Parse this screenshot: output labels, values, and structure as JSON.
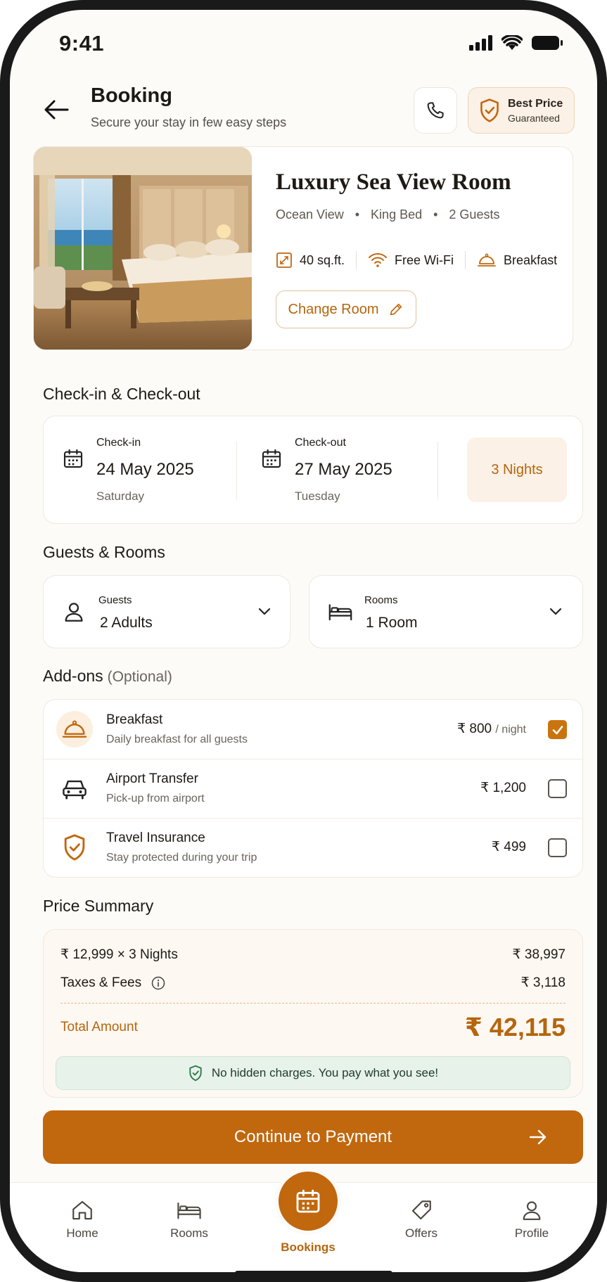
{
  "status_bar": {
    "time": "9:41"
  },
  "header": {
    "title": "Booking",
    "subtitle": "Secure your stay in few easy steps",
    "best_price_line1": "Best Price",
    "best_price_line2": "Guaranteed"
  },
  "room": {
    "title": "Luxury Sea View Room",
    "meta": [
      "Ocean View",
      "King Bed",
      "2 Guests"
    ],
    "features": [
      {
        "icon": "area-icon",
        "label": "40 sq.ft."
      },
      {
        "icon": "wifi-icon",
        "label": "Free Wi-Fi"
      },
      {
        "icon": "cloche-icon",
        "label": "Breakfast"
      }
    ],
    "change_label": "Change Room"
  },
  "dates": {
    "section_title": "Check-in & Check-out",
    "checkin": {
      "label": "Check-in",
      "date": "24 May 2025",
      "day": "Saturday"
    },
    "checkout": {
      "label": "Check-out",
      "date": "27 May 2025",
      "day": "Tuesday"
    },
    "nights": "3 Nights"
  },
  "guests": {
    "section_title": "Guests & Rooms",
    "guests_label": "Guests",
    "guests_value": "2 Adults",
    "rooms_label": "Rooms",
    "rooms_value": "1 Room"
  },
  "addons": {
    "section_title": "Add-ons",
    "optional": "(Optional)",
    "items": [
      {
        "name": "Breakfast",
        "desc": "Daily breakfast for all guests",
        "price": "₹ 800",
        "unit": "/ night",
        "checked": true
      },
      {
        "name": "Airport Transfer",
        "desc": "Pick-up from airport",
        "price": "₹ 1,200",
        "unit": "",
        "checked": false
      },
      {
        "name": "Travel Insurance",
        "desc": "Stay protected during your trip",
        "price": "₹ 499",
        "unit": "",
        "checked": false
      }
    ]
  },
  "price": {
    "section_title": "Price Summary",
    "rate_label": "₹ 12,999 × 3 Nights",
    "rate_value": "₹ 38,997",
    "taxes_label": "Taxes & Fees",
    "taxes_value": "₹ 3,118",
    "total_label": "Total Amount",
    "total_value": "₹ 42,115",
    "note": "No hidden charges. You pay what you see!"
  },
  "cta": {
    "label": "Continue to Payment"
  },
  "tabs": [
    {
      "label": "Home"
    },
    {
      "label": "Rooms"
    },
    {
      "label": "Bookings"
    },
    {
      "label": "Offers"
    },
    {
      "label": "Profile"
    }
  ],
  "colors": {
    "accent": "#c1670e",
    "accent_text": "#b5650d",
    "background": "#fdfbf8",
    "success_bg": "#e7f2ea"
  }
}
